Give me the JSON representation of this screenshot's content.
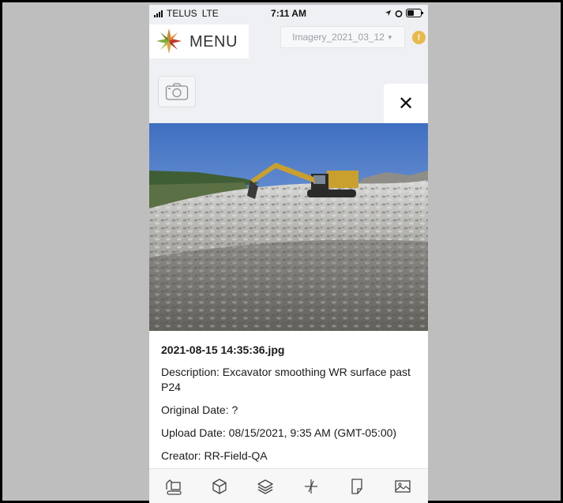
{
  "status_bar": {
    "carrier": "TELUS",
    "network": "LTE",
    "time": "7:11 AM"
  },
  "header": {
    "menu_label": "MENU",
    "imagery_select": "Imagery_2021_03_12",
    "alert_badge": "!"
  },
  "panel": {
    "close_label": "✕",
    "photo_alt": "Excavator on rock surface",
    "filename": "2021-08-15 14:35:36.jpg",
    "description": "Description: Excavator smoothing WR surface past P24",
    "original_date": "Original Date: ?",
    "upload_date": "Upload Date: 08/15/2021, 9:35 AM (GMT-05:00)",
    "creator": "Creator: RR-Field-QA"
  },
  "toolbar": {
    "tools": [
      "excavator-icon",
      "cube-icon",
      "layers-icon",
      "measure-icon",
      "document-icon",
      "image-icon"
    ]
  },
  "colors": {
    "alert": "#e9b94a",
    "background": "#bebebe",
    "panel": "#ffffff"
  }
}
